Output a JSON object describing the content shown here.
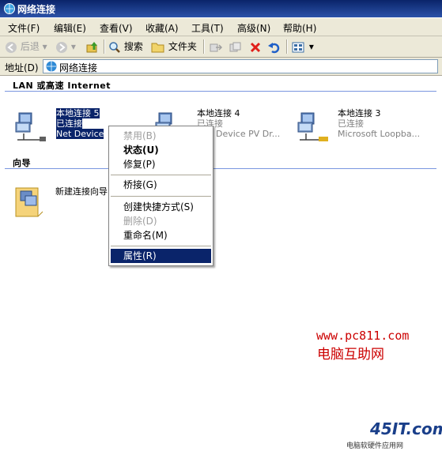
{
  "window": {
    "title": "网络连接"
  },
  "menu": [
    "文件(F)",
    "编辑(E)",
    "查看(V)",
    "收藏(A)",
    "工具(T)",
    "高级(N)",
    "帮助(H)"
  ],
  "toolbar": {
    "back": "后退",
    "search": "搜索",
    "folders": "文件夹"
  },
  "address": {
    "label": "地址(D)",
    "value": "网络连接"
  },
  "groups": {
    "lan": "LAN 或高速 Internet",
    "wizard": "向导"
  },
  "connections": [
    {
      "name": "本地连接 5",
      "status": "已连接",
      "device": "Net Device"
    },
    {
      "name": "本地连接 4",
      "status": "已连接",
      "device": "Device PV Dr..."
    },
    {
      "name": "本地连接 3",
      "status": "已连接",
      "device": "Microsoft Loopba..."
    }
  ],
  "wizard_item": "新建连接向导",
  "context_menu": [
    "禁用(B)",
    "状态(U)",
    "修复(P)",
    "桥接(G)",
    "创建快捷方式(S)",
    "删除(D)",
    "重命名(M)",
    "属性(R)"
  ],
  "watermark": {
    "url": "www.pc811.com",
    "name": "电脑互助网",
    "logo": "45IT.com",
    "logo_sub": "电脑软硬件应用网"
  },
  "colors": {
    "title": "#0a246a",
    "highlight": "#0a246a",
    "watermark": "#cc0000"
  }
}
